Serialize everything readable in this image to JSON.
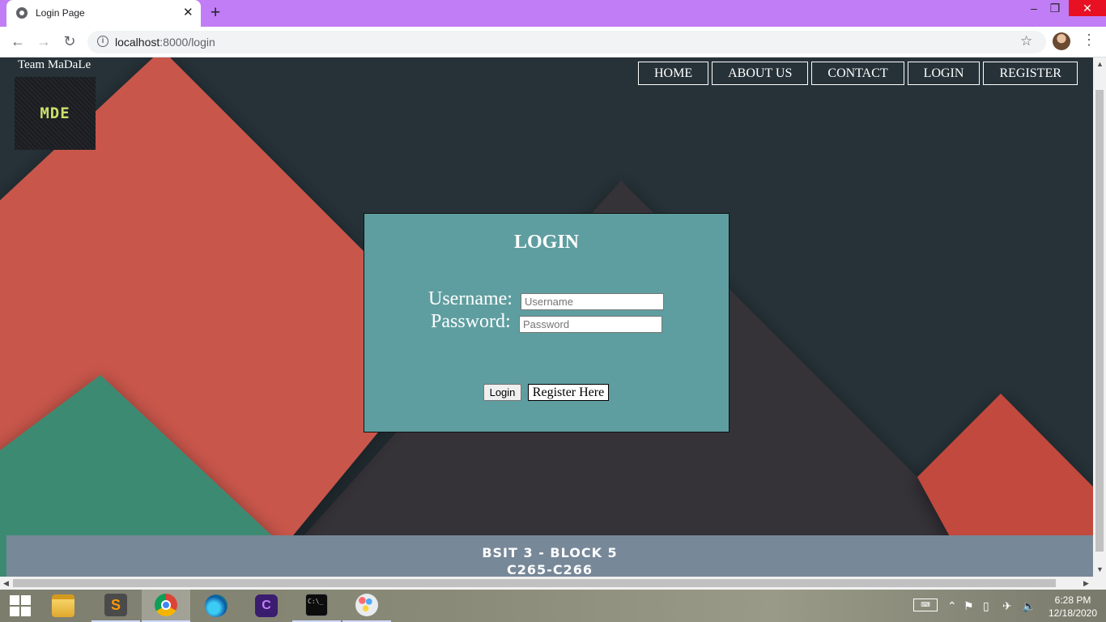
{
  "browser": {
    "tab_title": "Login Page",
    "tab_close": "✕",
    "new_tab": "+",
    "url_host": "localhost",
    "url_rest": ":8000/login",
    "minimize": "–",
    "restore": "❐",
    "close": "✕"
  },
  "page": {
    "team_name": "Team MaDaLe",
    "logo_text": "MDE",
    "nav": [
      "HOME",
      "ABOUT US",
      "CONTACT",
      "LOGIN",
      "REGISTER"
    ],
    "login": {
      "title": "LOGIN",
      "username_label": "Username:",
      "username_placeholder": "Username",
      "password_label": "Password:",
      "password_placeholder": "Password",
      "login_button": "Login",
      "register_link": "Register Here"
    },
    "footer": {
      "line1": "BSIT 3 - BLOCK 5",
      "line2": "C265-C266"
    }
  },
  "taskbar": {
    "time": "6:28 PM",
    "date": "12/18/2020",
    "apps": [
      "file-explorer",
      "sublime-text",
      "chrome",
      "edge",
      "app-purple",
      "command-prompt",
      "paint"
    ]
  },
  "colors": {
    "tab_bar": "#c17df5",
    "login_box": "#5f9ea0",
    "footer": "#778899",
    "bg_dark": "#263238",
    "bg_red": "#c9574b",
    "bg_teal": "#3c8a73"
  }
}
